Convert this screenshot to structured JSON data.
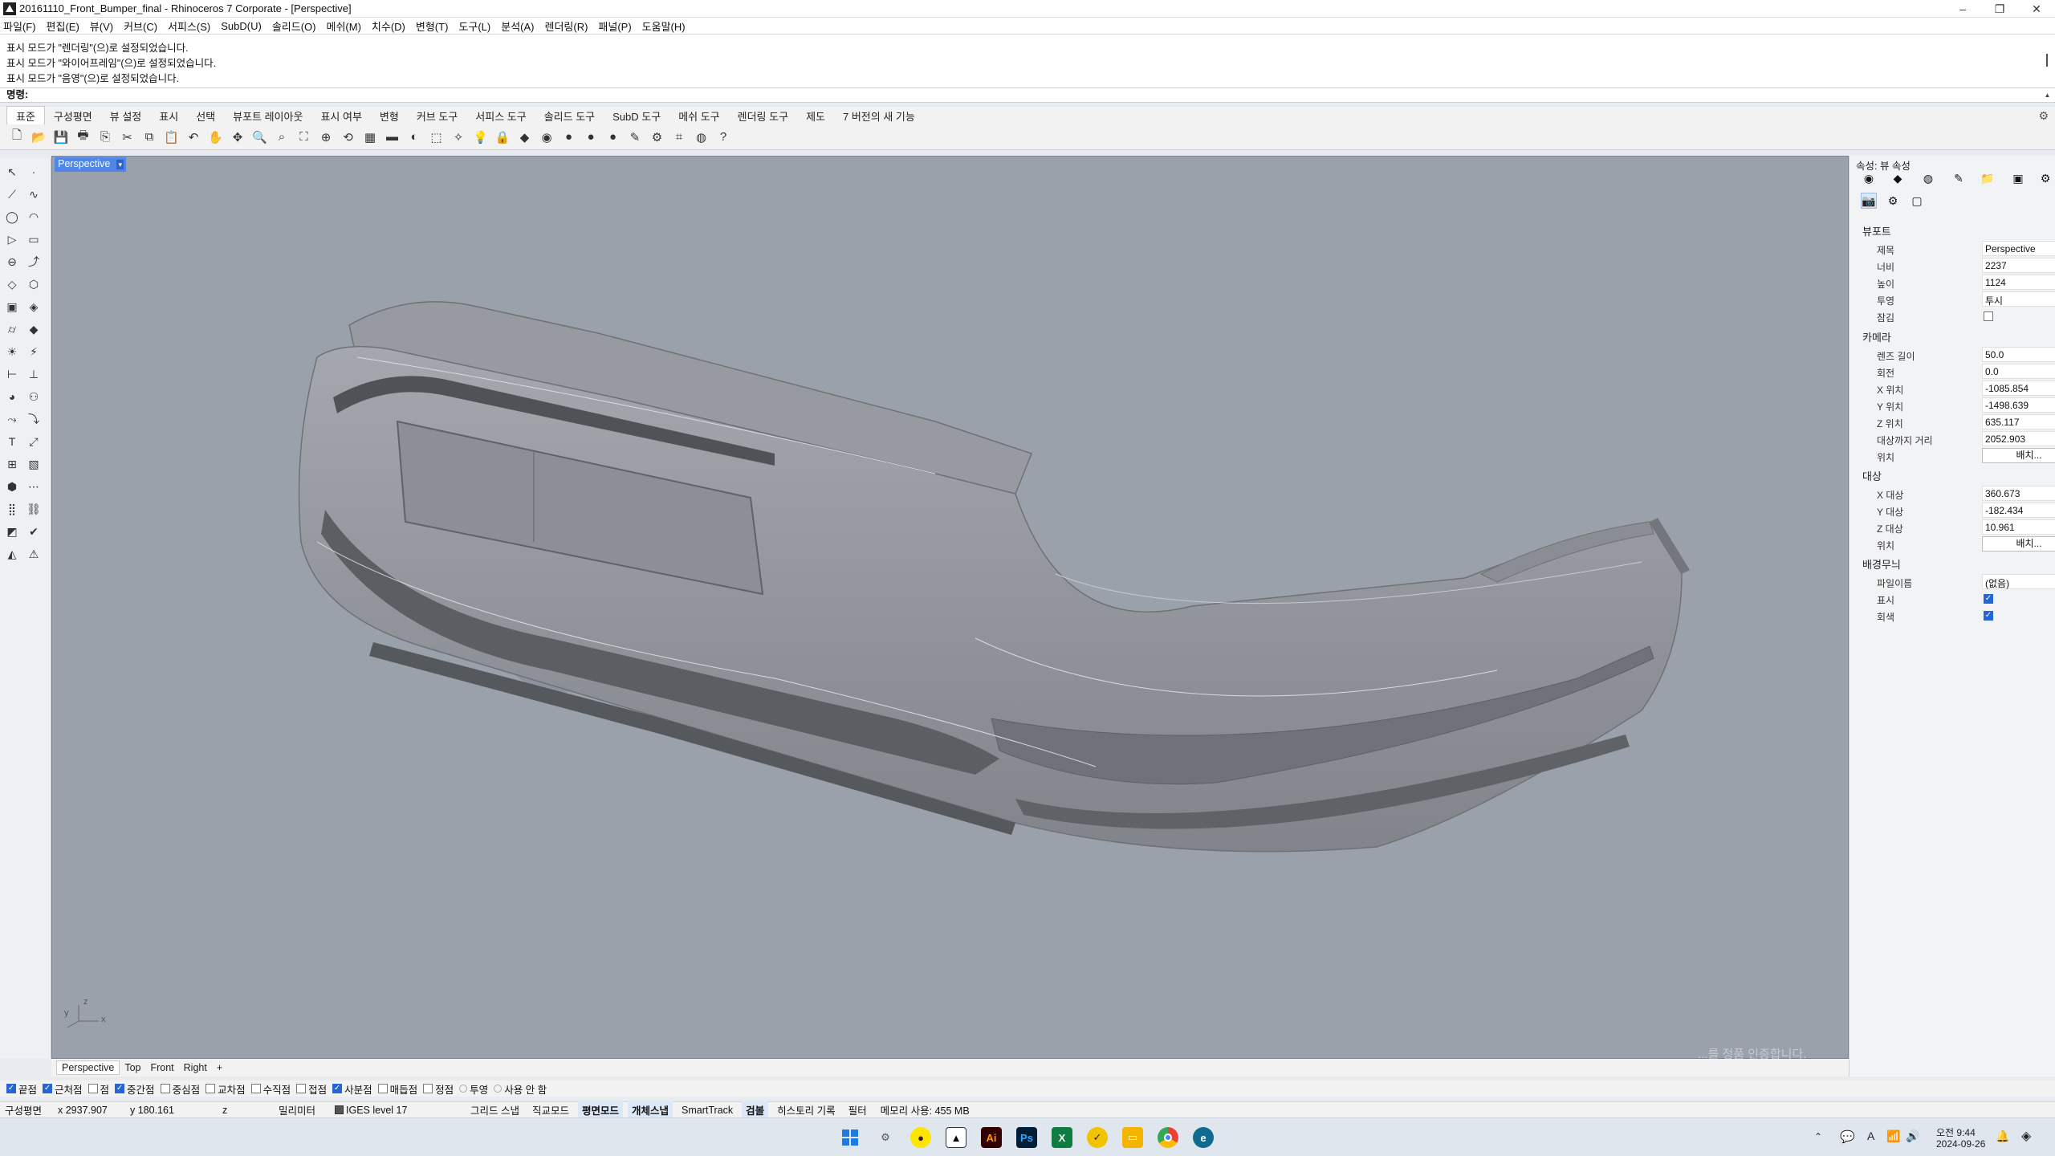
{
  "window": {
    "title": "20161110_Front_Bumper_final - Rhinoceros 7 Corporate - [Perspective]",
    "minimize": "–",
    "maximize": "❐",
    "close": "✕"
  },
  "menu": [
    "파일(F)",
    "편집(E)",
    "뷰(V)",
    "커브(C)",
    "서피스(S)",
    "SubD(U)",
    "솔리드(O)",
    "메쉬(M)",
    "치수(D)",
    "변형(T)",
    "도구(L)",
    "분석(A)",
    "렌더링(R)",
    "패널(P)",
    "도움말(H)"
  ],
  "command_history": [
    "표시 모드가 \"렌더링\"(으)로 설정되었습니다.",
    "표시 모드가 \"와이어프레임\"(으)로 설정되었습니다.",
    "표시 모드가 \"음영\"(으)로 설정되었습니다."
  ],
  "command_prompt": "명령:",
  "toolbar_tabs": [
    "표준",
    "구성평면",
    "뷰 설정",
    "표시",
    "선택",
    "뷰포트 레이아웃",
    "표시 여부",
    "변형",
    "커브 도구",
    "서피스 도구",
    "솔리드 도구",
    "SubD 도구",
    "메쉬 도구",
    "렌더링 도구",
    "제도",
    "7 버전의 새 기능"
  ],
  "active_toolbar_tab": "표준",
  "viewport": {
    "name": "Perspective",
    "bg_color": "#9aa1ab",
    "tabs": [
      "Perspective",
      "Top",
      "Front",
      "Right"
    ],
    "add_tab": "+",
    "axis_z": "z",
    "axis_y": "y",
    "axis_x": "x",
    "watermark": "...를 정품 인증합니다."
  },
  "properties_panel": {
    "title": "속성: 뷰 속성",
    "viewport_section": "뷰포트",
    "viewport_rows": [
      {
        "label": "제목",
        "value": "Perspective"
      },
      {
        "label": "너비",
        "value": "2237"
      },
      {
        "label": "높이",
        "value": "1124"
      },
      {
        "label": "투영",
        "value": "투시"
      },
      {
        "label": "잠김",
        "checked": false
      }
    ],
    "camera_section": "카메라",
    "camera_rows": [
      {
        "label": "렌즈 길이",
        "value": "50.0"
      },
      {
        "label": "회전",
        "value": "0.0"
      },
      {
        "label": "X 위치",
        "value": "-1085.854"
      },
      {
        "label": "Y 위치",
        "value": "-1498.639"
      },
      {
        "label": "Z 위치",
        "value": "635.117"
      },
      {
        "label": "대상까지 거리",
        "value": "2052.903"
      },
      {
        "label": "위치",
        "button": "배치..."
      }
    ],
    "target_section": "대상",
    "target_rows": [
      {
        "label": "X 대상",
        "value": "360.673"
      },
      {
        "label": "Y 대상",
        "value": "-182.434"
      },
      {
        "label": "Z 대상",
        "value": "10.961"
      },
      {
        "label": "위치",
        "button": "배치..."
      }
    ],
    "wallpaper_section": "배경무늬",
    "wallpaper_rows": [
      {
        "label": "파일이름",
        "value": "(없음)"
      },
      {
        "label": "표시",
        "checked": true
      },
      {
        "label": "회색",
        "checked": true
      }
    ]
  },
  "osnaps": [
    {
      "label": "끝점",
      "checked": true
    },
    {
      "label": "근처점",
      "checked": true
    },
    {
      "label": "점",
      "checked": false
    },
    {
      "label": "중간점",
      "checked": true
    },
    {
      "label": "중심점",
      "checked": false
    },
    {
      "label": "교차점",
      "checked": false
    },
    {
      "label": "수직점",
      "checked": false
    },
    {
      "label": "접점",
      "checked": false
    },
    {
      "label": "사분점",
      "checked": true
    },
    {
      "label": "매듭점",
      "checked": false
    },
    {
      "label": "정점",
      "checked": false
    },
    {
      "label": "투영",
      "radio": true
    },
    {
      "label": "사용 안 함",
      "radio": true
    }
  ],
  "status": {
    "cplane": "구성평면",
    "x": "x 2937.907",
    "y": "y 180.161",
    "z": "z",
    "units": "밀리미터",
    "layer": "IGES level 17",
    "panes": [
      {
        "label": "그리드 스냅",
        "on": false
      },
      {
        "label": "직교모드",
        "on": false
      },
      {
        "label": "평면모드",
        "on": true
      },
      {
        "label": "개체스냅",
        "on": true
      },
      {
        "label": "SmartTrack",
        "on": false
      },
      {
        "label": "검볼",
        "on": true
      },
      {
        "label": "히스토리 기록",
        "on": false
      },
      {
        "label": "필터",
        "on": false
      }
    ],
    "memory": "메모리 사용: 455 MB"
  },
  "taskbar": {
    "time": "오전 9:44",
    "date": "2024-09-26",
    "ime": "A",
    "apps": [
      "windows-start",
      "settings",
      "kakaotalk",
      "rhino",
      "illustrator",
      "photoshop",
      "excel",
      "norton",
      "file-explorer",
      "chrome",
      "edge-dev"
    ],
    "app_labels": {
      "illustrator": "Ai",
      "photoshop": "Ps",
      "excel": "X"
    }
  },
  "colors": {
    "accent": "#4f86e8",
    "viewport_bg": "#9aa1ab",
    "model_fill": "#8f9399",
    "model_dark": "#55585d",
    "checkbox": "#2566d6"
  }
}
